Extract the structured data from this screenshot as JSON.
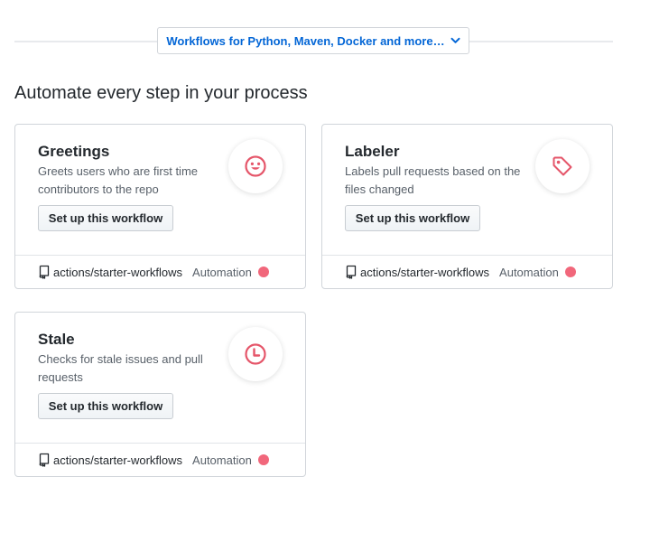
{
  "workflows_more_button": {
    "label": "Workflows for Python, Maven, Docker and more…",
    "icon": "chevron-down-icon"
  },
  "section": {
    "title": "Automate every step in your process"
  },
  "cards": [
    {
      "title": "Greetings",
      "description": "Greets users who are first time contributors to the repo",
      "button_label": "Set up this workflow",
      "icon": "smiley-icon",
      "repo": "actions/starter-workflows",
      "category": "Automation",
      "category_color": "#f1677b"
    },
    {
      "title": "Labeler",
      "description": "Labels pull requests based on the files changed",
      "button_label": "Set up this workflow",
      "icon": "tag-icon",
      "repo": "actions/starter-workflows",
      "category": "Automation",
      "category_color": "#f1677b"
    },
    {
      "title": "Stale",
      "description": "Checks for stale issues and pull requests",
      "button_label": "Set up this workflow",
      "icon": "clock-icon",
      "repo": "actions/starter-workflows",
      "category": "Automation",
      "category_color": "#f1677b"
    }
  ],
  "colors": {
    "icon_accent": "#e5566a",
    "link_blue": "#0366d6"
  }
}
